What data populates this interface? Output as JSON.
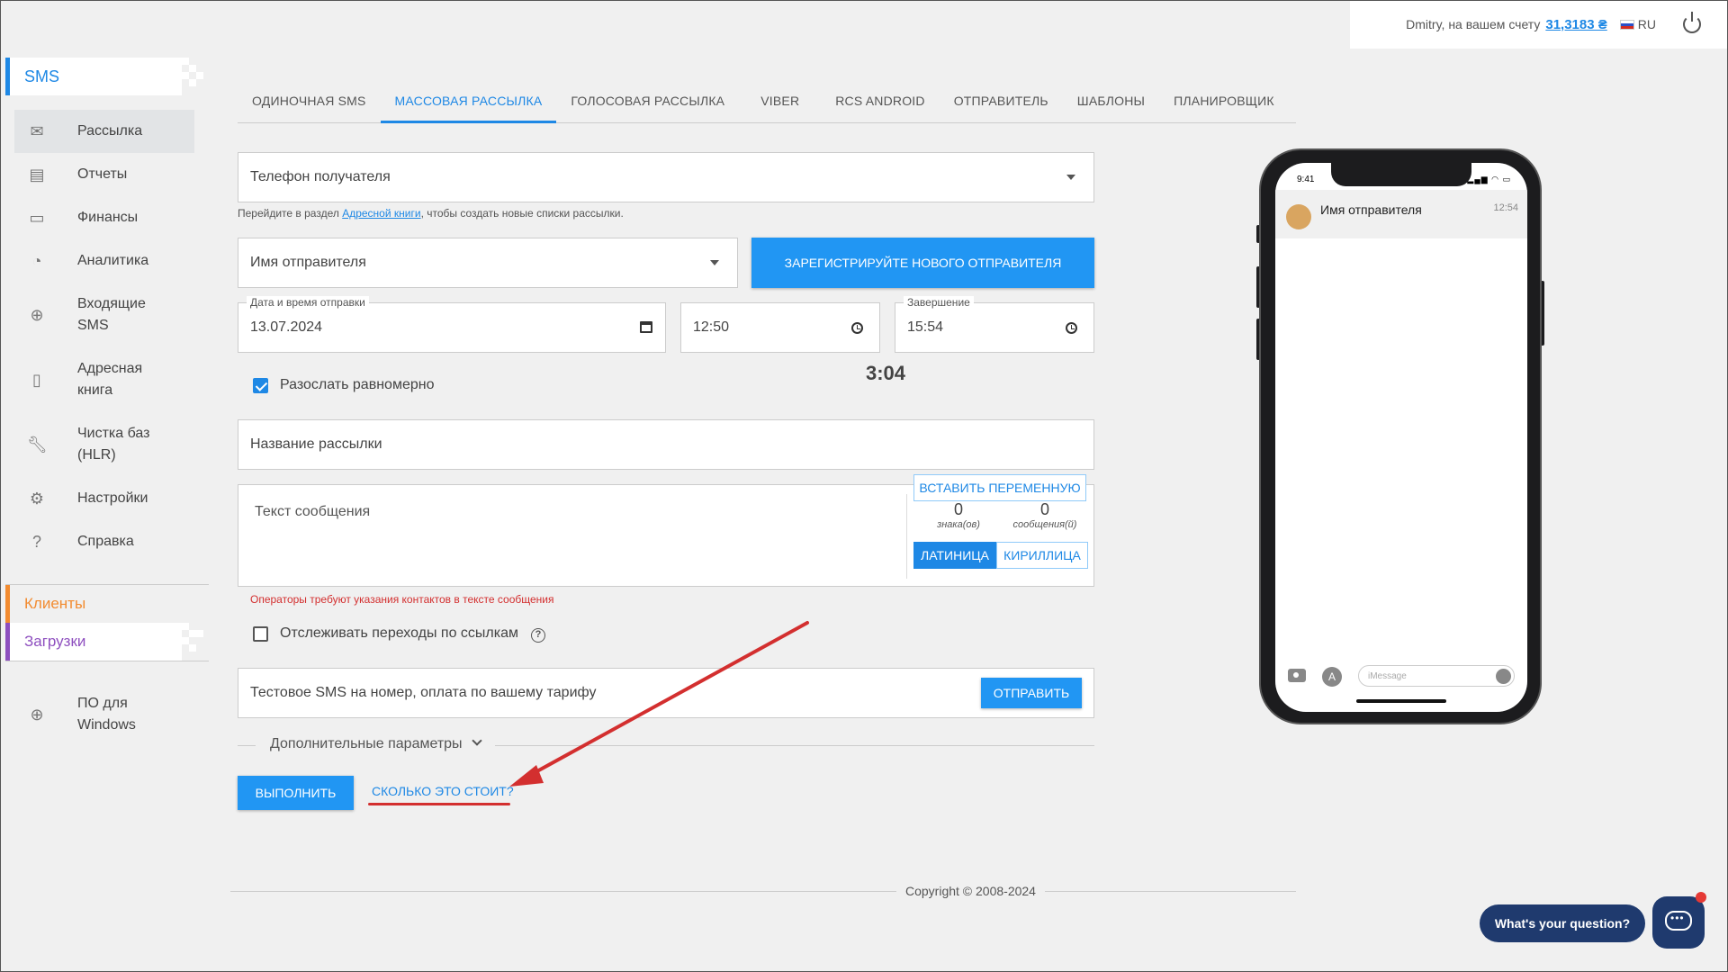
{
  "header": {
    "user_text": "Dmitry, на вашем счету",
    "balance": "31,3183 ₴",
    "lang": "RU"
  },
  "sidebar": {
    "section": "SMS",
    "items": [
      {
        "label": "Рассылка",
        "icon": "envelope-icon"
      },
      {
        "label": "Отчеты",
        "icon": "document-icon"
      },
      {
        "label": "Финансы",
        "icon": "wallet-icon"
      },
      {
        "label": "Аналитика",
        "icon": "pie-chart-icon"
      },
      {
        "label": "Входящие SMS",
        "icon": "inbox-download-icon"
      },
      {
        "label": "Адресная книга",
        "icon": "address-book-icon"
      },
      {
        "label": "Чистка баз (HLR)",
        "icon": "wrench-icon"
      },
      {
        "label": "Настройки",
        "icon": "gear-icon"
      },
      {
        "label": "Справка",
        "icon": "help-icon"
      }
    ],
    "clients": "Клиенты",
    "downloads": "Загрузки",
    "windows": "ПО для Windows"
  },
  "tabs": [
    "ОДИНОЧНАЯ SMS",
    "МАССОВАЯ РАССЫЛКА",
    "ГОЛОСОВАЯ РАССЫЛКА",
    "VIBER",
    "RCS ANDROID",
    "ОТПРАВИТЕЛЬ",
    "ШАБЛОНЫ",
    "ПЛАНИРОВЩИК"
  ],
  "form": {
    "recipient_placeholder": "Телефон получателя",
    "hint_before": "Перейдите в раздел ",
    "hint_link": "Адресной книги",
    "hint_after": ", чтобы создать новые списки рассылки.",
    "sender_placeholder": "Имя отправителя",
    "register_sender": "ЗАРЕГИСТРИРУЙТЕ НОВОГО ОТПРАВИТЕЛЯ",
    "date_label": "Дата и время отправки",
    "date_value": "13.07.2024",
    "time_value": "12:50",
    "end_label": "Завершение",
    "end_value": "15:54",
    "duration": "3:04",
    "evenly_label": "Разослать равномерно",
    "campaign_name_placeholder": "Название рассылки",
    "message_placeholder": "Текст сообщения",
    "insert_variable": "ВСТАВИТЬ ПЕРЕМЕННУЮ",
    "chars_count": "0",
    "chars_label": "знака(ов)",
    "msgs_count": "0",
    "msgs_label": "сообщения(й)",
    "latin": "ЛАТИНИЦА",
    "cyrillic": "КИРИЛЛИЦА",
    "warning": "Операторы требуют указания контактов в тексте сообщения",
    "track_links_label": "Отслеживать переходы по ссылкам",
    "test_sms_placeholder": "Тестовое SMS на номер, оплата по вашему тарифу",
    "send": "ОТПРАВИТЬ",
    "extra_params": "Дополнительные параметры",
    "execute": "ВЫПОЛНИТЬ",
    "cost_link": "СКОЛЬКО ЭТО СТОИТ?"
  },
  "phone": {
    "status_time": "9:41",
    "sender_name": "Имя отправителя",
    "msg_time": "12:54",
    "input_placeholder": "iMessage"
  },
  "footer": {
    "copyright": "Copyright © 2008-2024"
  },
  "chat": {
    "prompt": "What's your question?"
  },
  "colors": {
    "accent": "#1e88e5",
    "clients": "#f28b30",
    "downloads": "#8e4fbf",
    "warning": "#d32f2f",
    "annotation_arrow": "#d32f2f"
  }
}
